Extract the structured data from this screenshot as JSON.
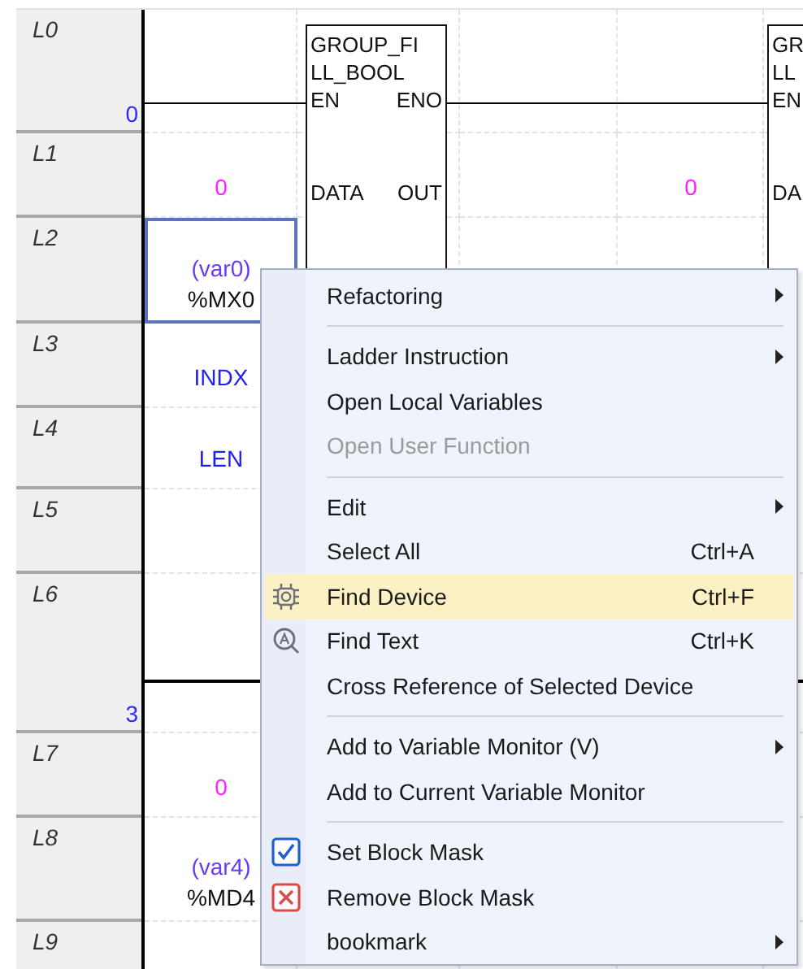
{
  "lines": [
    {
      "label": "L0",
      "step": "0"
    },
    {
      "label": "L1",
      "left": {
        "kind": "constant",
        "value": "0",
        "selected": false
      },
      "right": {
        "kind": "constant",
        "value": "0",
        "selected": false
      }
    },
    {
      "label": "L2",
      "left": {
        "kind": "variable",
        "comment": "(var0)",
        "address": "%MX0",
        "selected": true
      }
    },
    {
      "label": "L3",
      "left": {
        "kind": "operand",
        "value": "INDX",
        "selected": false
      }
    },
    {
      "label": "L4",
      "left": {
        "kind": "operand",
        "value": "LEN",
        "selected": false
      }
    },
    {
      "label": "L5"
    },
    {
      "label": "L6",
      "step": "3"
    },
    {
      "label": "L7",
      "left": {
        "kind": "constant",
        "value": "0",
        "selected": false
      }
    },
    {
      "label": "L8",
      "left": {
        "kind": "variable",
        "comment": "(var4)",
        "address": "%MD4",
        "selected": false
      }
    },
    {
      "label": "L9"
    }
  ],
  "blocks": [
    {
      "title": [
        "GROUP_FI",
        "LL_BOOL"
      ],
      "clipped": false,
      "pins": [
        {
          "left": "EN",
          "right": "ENO"
        },
        {
          "left": "DATA",
          "right": "OUT"
        }
      ]
    },
    {
      "title": [
        "GR",
        "LL"
      ],
      "clipped": true,
      "pins": [
        {
          "left": "EN"
        },
        {
          "left": "DA"
        }
      ]
    }
  ],
  "context_menu": {
    "items": [
      {
        "kind": "item",
        "label": "Refactoring",
        "submenu": true,
        "disabled": false,
        "selected": false
      },
      {
        "kind": "separator"
      },
      {
        "kind": "item",
        "label": "Ladder Instruction",
        "submenu": true,
        "disabled": false,
        "selected": false
      },
      {
        "kind": "item",
        "label": "Open Local Variables",
        "submenu": false,
        "disabled": false,
        "selected": false
      },
      {
        "kind": "item",
        "label": "Open User Function",
        "submenu": false,
        "disabled": true,
        "selected": false
      },
      {
        "kind": "separator"
      },
      {
        "kind": "item",
        "label": "Edit",
        "submenu": true,
        "disabled": false,
        "selected": false
      },
      {
        "kind": "item",
        "label": "Select All",
        "shortcut": "Ctrl+A",
        "submenu": false,
        "disabled": false,
        "selected": false
      },
      {
        "kind": "device",
        "label": "Find Device",
        "shortcut": "Ctrl+F",
        "submenu": false,
        "disabled": false,
        "selected": true
      },
      {
        "kind": "search",
        "label": "Find Text",
        "shortcut": "Ctrl+K",
        "submenu": false,
        "disabled": false,
        "selected": false
      },
      {
        "kind": "item",
        "label": "Cross Reference of Selected Device",
        "submenu": false,
        "disabled": false,
        "selected": false
      },
      {
        "kind": "separator"
      },
      {
        "kind": "item",
        "label": "Add to Variable Monitor (V)",
        "submenu": true,
        "disabled": false,
        "selected": false
      },
      {
        "kind": "item",
        "label": "Add to Current Variable Monitor",
        "submenu": false,
        "disabled": false,
        "selected": false
      },
      {
        "kind": "separator"
      },
      {
        "kind": "mask",
        "label": "Set Block Mask",
        "submenu": false,
        "disabled": false,
        "selected": false
      },
      {
        "kind": "unmask",
        "label": "Remove Block Mask",
        "submenu": false,
        "disabled": false,
        "selected": false
      },
      {
        "kind": "item",
        "label": "bookmark",
        "submenu": true,
        "disabled": false,
        "selected": false
      }
    ]
  }
}
